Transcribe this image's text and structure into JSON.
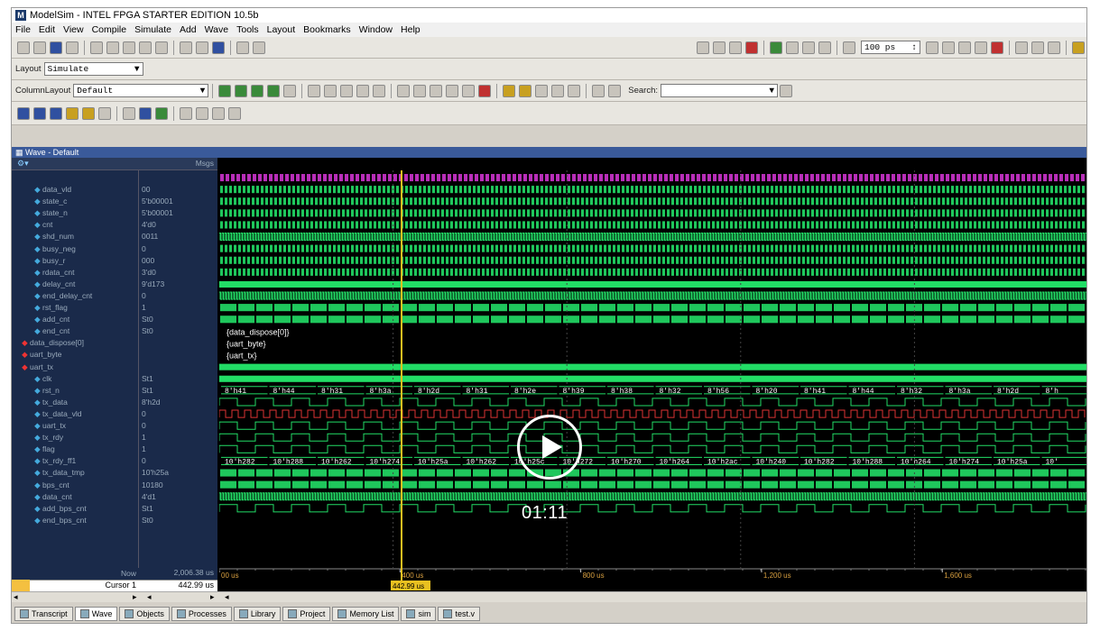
{
  "window": {
    "title": "ModelSim - INTEL FPGA STARTER EDITION 10.5b"
  },
  "menu": [
    "File",
    "Edit",
    "View",
    "Compile",
    "Simulate",
    "Add",
    "Wave",
    "Tools",
    "Layout",
    "Bookmarks",
    "Window",
    "Help"
  ],
  "toolbar1": {
    "time_step": "100 ps"
  },
  "layout_bar": {
    "label": "Layout",
    "value": "Simulate"
  },
  "column_bar": {
    "label": "ColumnLayout",
    "value": "Default",
    "search_placeholder": "Search:"
  },
  "wave_panel": {
    "title": "Wave - Default",
    "msgs_header": "Msgs"
  },
  "signals": [
    {
      "name": "data_vld",
      "value": "00"
    },
    {
      "name": "state_c",
      "value": "5'b00001"
    },
    {
      "name": "state_n",
      "value": "5'b00001"
    },
    {
      "name": "cnt",
      "value": "4'd0"
    },
    {
      "name": "shd_num",
      "value": "0011"
    },
    {
      "name": "busy_neg",
      "value": "0"
    },
    {
      "name": "busy_r",
      "value": "000"
    },
    {
      "name": "rdata_cnt",
      "value": "3'd0"
    },
    {
      "name": "delay_cnt",
      "value": "9'd173"
    },
    {
      "name": "end_delay_cnt",
      "value": "0"
    },
    {
      "name": "rst_flag",
      "value": "1"
    },
    {
      "name": "add_cnt",
      "value": "St0"
    },
    {
      "name": "end_cnt",
      "value": "St0"
    },
    {
      "name": "data_dispose[0]",
      "value": ""
    },
    {
      "name": "uart_byte",
      "value": ""
    },
    {
      "name": "uart_tx",
      "value": ""
    },
    {
      "name": "clk",
      "value": "St1"
    },
    {
      "name": "rst_n",
      "value": "St1"
    },
    {
      "name": "tx_data",
      "value": "8'h2d"
    },
    {
      "name": "tx_data_vld",
      "value": "0"
    },
    {
      "name": "uart_tx",
      "value": "0"
    },
    {
      "name": "tx_rdy",
      "value": "1"
    },
    {
      "name": "flag",
      "value": "1"
    },
    {
      "name": "tx_rdy_ff1",
      "value": "0"
    },
    {
      "name": "tx_data_tmp",
      "value": "10'h25a"
    },
    {
      "name": "bps_cnt",
      "value": "10180"
    },
    {
      "name": "data_cnt",
      "value": "4'd1"
    },
    {
      "name": "add_bps_cnt",
      "value": "St1"
    },
    {
      "name": "end_bps_cnt",
      "value": "St0"
    }
  ],
  "group_labels": [
    "{data_dispose[0]}",
    "{uart_byte}",
    "{uart_tx}"
  ],
  "tx_data_values": [
    "8'h41",
    "8'h44",
    "8'h31",
    "8'h3a",
    "8'h2d",
    "8'h31",
    "8'h2e",
    "8'h39",
    "8'h38",
    "8'h32",
    "8'h56",
    "8'h20",
    "8'h41",
    "8'h44",
    "8'h32",
    "8'h3a",
    "8'h2d",
    "8'h"
  ],
  "tx_tmp_values": [
    "10'h282",
    "10'h288",
    "10'h262",
    "10'h274",
    "10'h25a",
    "10'h262",
    "10'h25c",
    "10'h272",
    "10'h270",
    "10'h264",
    "10'h2ac",
    "10'h240",
    "10'h282",
    "10'h288",
    "10'h264",
    "10'h274",
    "10'h25a",
    "10'"
  ],
  "status": {
    "now_label": "Now",
    "now_value": "2,006.38 us",
    "cursor_label": "Cursor 1",
    "cursor_value": "442.99 us",
    "cursor_tag": "442.99 us"
  },
  "time_ticks": [
    "00 us",
    "400 us",
    "800 us",
    "1,200 us",
    "1,600 us"
  ],
  "player": {
    "timecode": "01:11"
  },
  "tabs": [
    "Transcript",
    "Wave",
    "Objects",
    "Processes",
    "Library",
    "Project",
    "Memory List",
    "sim",
    "test.v"
  ],
  "colors": {
    "signal_green": "#22dd66",
    "signal_magenta": "#cc33cc",
    "cursor": "#e8c020"
  }
}
